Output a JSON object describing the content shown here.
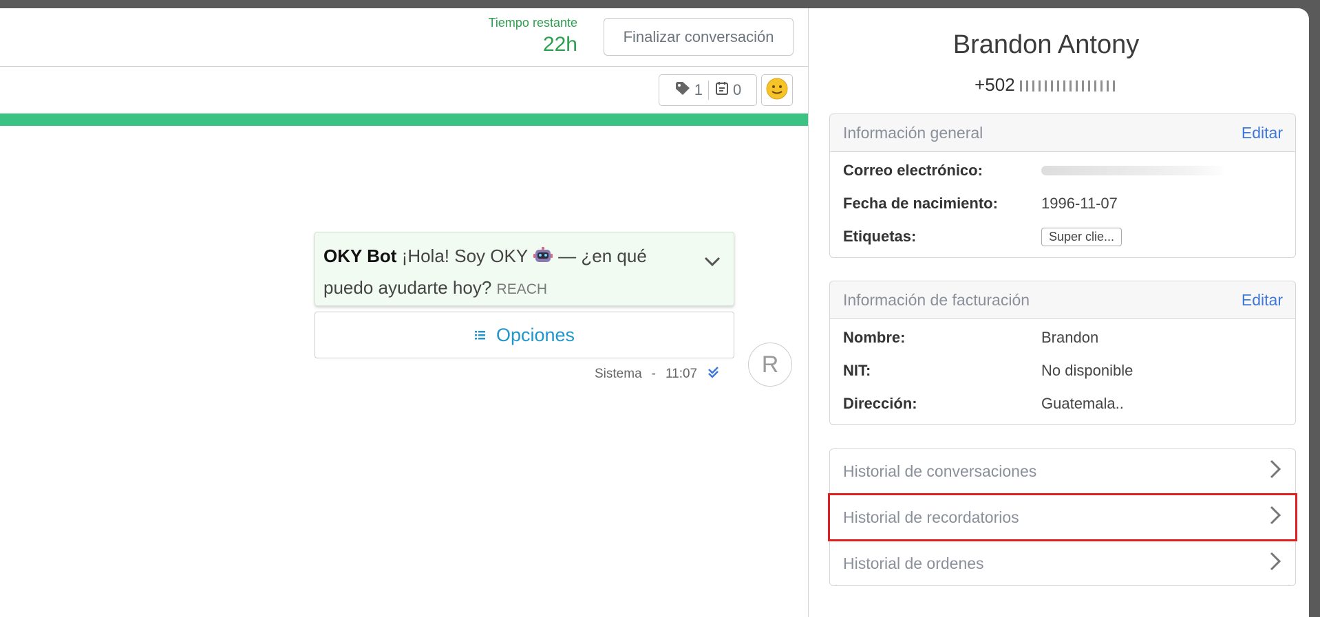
{
  "chat": {
    "remaining_label": "Tiempo restante",
    "remaining_value": "22h",
    "finish_button": "Finalizar conversación",
    "tags_count": "1",
    "notes_count": "0",
    "progress_fraction": 1.0,
    "progress_color": "#3cc384",
    "message": {
      "sender": "OKY Bot",
      "text_before_emoji": "¡Hola! Soy OKY",
      "text_after_emoji": "— ¿en qué puedo ayudarte hoy?",
      "channel_tag": "REACH",
      "options_label": "Opciones",
      "meta_author": "Sistema",
      "meta_sep": "-",
      "meta_time": "11:07"
    },
    "avatar_initial": "R"
  },
  "contact": {
    "name": "Brandon Antony",
    "phone_prefix": "+502",
    "general": {
      "title": "Información general",
      "edit": "Editar",
      "rows": [
        {
          "label": "Correo electrónico:",
          "value": ""
        },
        {
          "label": "Fecha de nacimiento:",
          "value": "1996-11-07"
        },
        {
          "label": "Etiquetas:",
          "value": "Super clie..."
        }
      ]
    },
    "billing": {
      "title": "Información de facturación",
      "edit": "Editar",
      "rows": [
        {
          "label": "Nombre:",
          "value": "Brandon"
        },
        {
          "label": "NIT:",
          "value": "No disponible"
        },
        {
          "label": "Dirección:",
          "value": "Guatemala.."
        }
      ]
    },
    "history": [
      {
        "label": "Historial de conversaciones"
      },
      {
        "label": "Historial de recordatorios"
      },
      {
        "label": "Historial de ordenes"
      }
    ]
  }
}
